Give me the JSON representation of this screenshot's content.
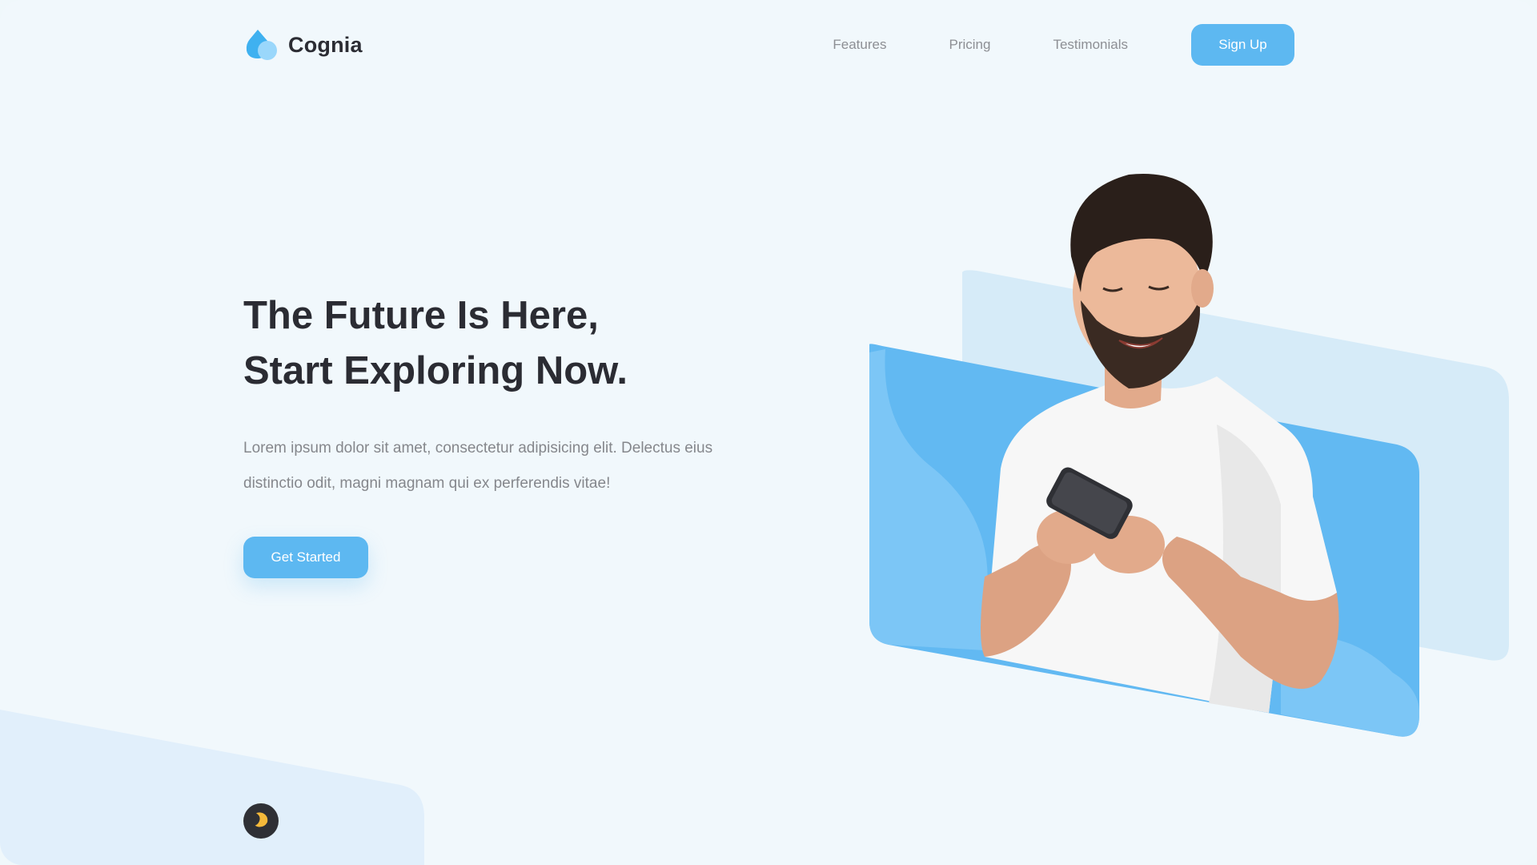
{
  "brand": {
    "name": "Cognia",
    "logo_icon": "droplet-logo-icon",
    "accent_color": "#5db8f1"
  },
  "nav": {
    "items": [
      {
        "label": "Features"
      },
      {
        "label": "Pricing"
      },
      {
        "label": "Testimonials"
      }
    ],
    "signup_label": "Sign Up"
  },
  "hero": {
    "title_line1": "The Future Is Here,",
    "title_line2": "Start Exploring Now.",
    "description": "Lorem ipsum dolor sit amet, consectetur adipisicing elit. Delectus eius distinctio odit, magni magnam qui ex perferendis vitae!",
    "cta_label": "Get Started"
  },
  "illustration": {
    "subject": "smiling-man-using-phone-photo",
    "panel_colors": [
      "#d6ebf8",
      "#62b9f2"
    ]
  },
  "theme_toggle": {
    "icon": "moon-icon"
  }
}
